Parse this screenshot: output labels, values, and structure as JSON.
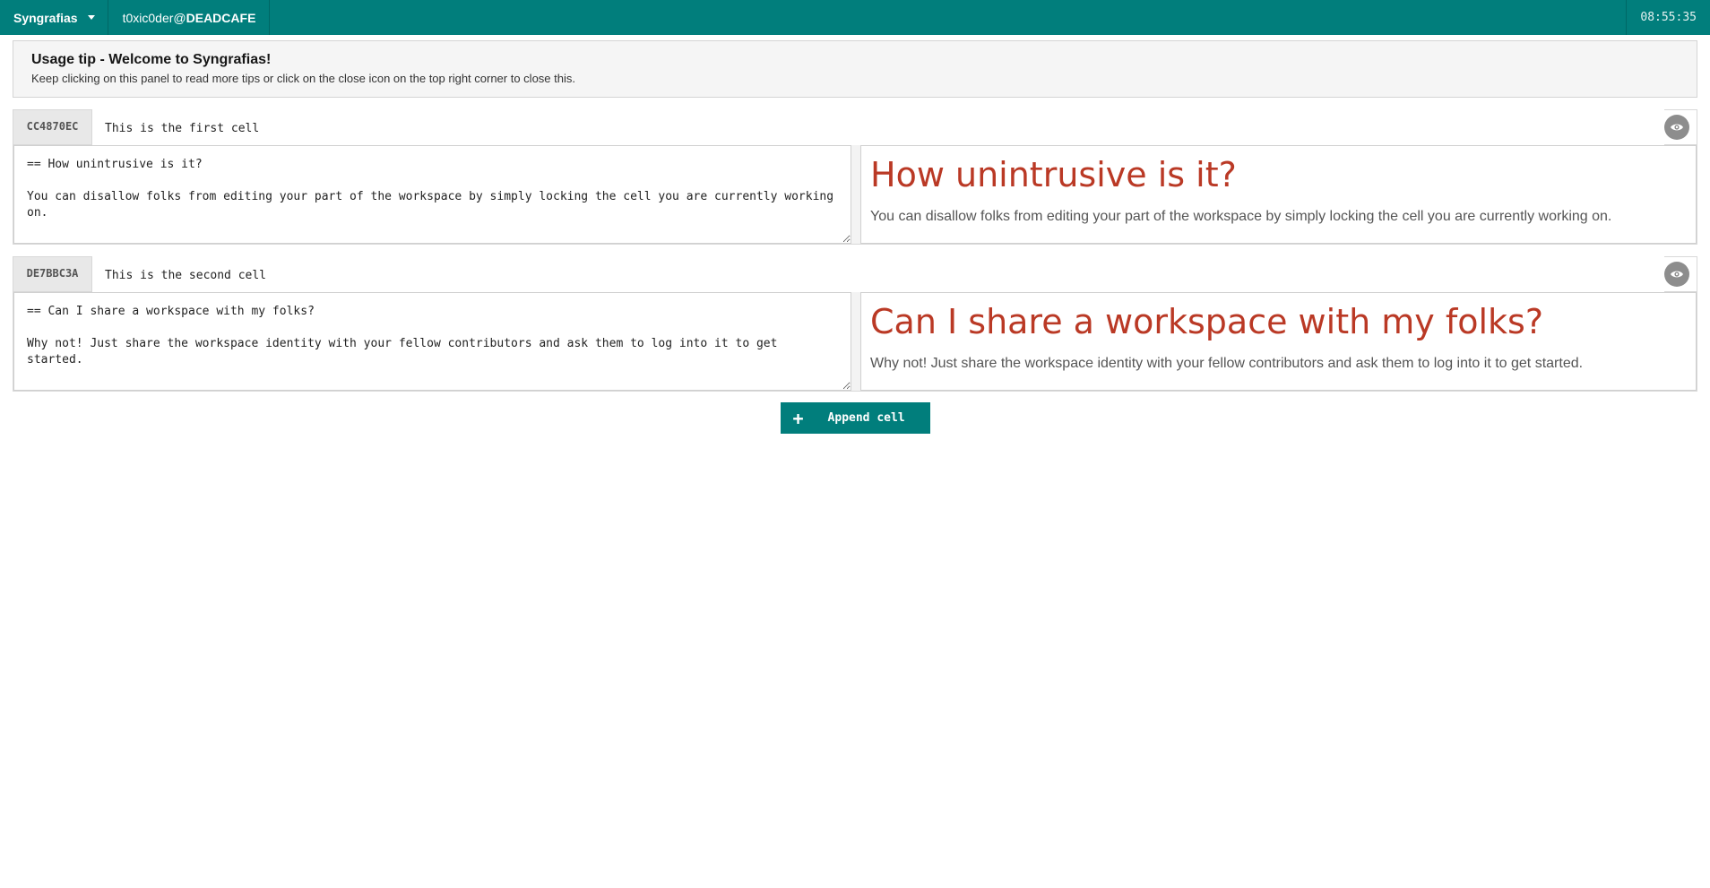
{
  "topbar": {
    "app_name": "Syngrafias",
    "user_prefix": "t0xic0der@",
    "user_workspace": "DEADCAFE",
    "clock": "08:55:35"
  },
  "tip": {
    "title": "Usage tip - Welcome to Syngrafias!",
    "body": "Keep clicking on this panel to read more tips or click on the close icon on the top right corner to close this."
  },
  "cells": [
    {
      "id": "CC4870EC",
      "title": "This is the first cell",
      "editor_text": "== How unintrusive is it?\n\nYou can disallow folks from editing your part of the workspace by simply locking the cell you are currently working on.",
      "preview_heading": "How unintrusive is it?",
      "preview_body": "You can disallow folks from editing your part of the workspace by simply locking the cell you are currently working on."
    },
    {
      "id": "DE7BBC3A",
      "title": "This is the second cell",
      "editor_text": "== Can I share a workspace with my folks?\n\nWhy not! Just share the workspace identity with your fellow contributors and ask them to log into it to get started.",
      "preview_heading": "Can I share a workspace with my folks?",
      "preview_body": "Why not! Just share the workspace identity with your fellow contributors and ask them to log into it to get started."
    }
  ],
  "append": {
    "icon": "plus-icon",
    "label": "Append cell"
  },
  "colors": {
    "brand": "#017e7c",
    "heading": "#ba3925"
  }
}
